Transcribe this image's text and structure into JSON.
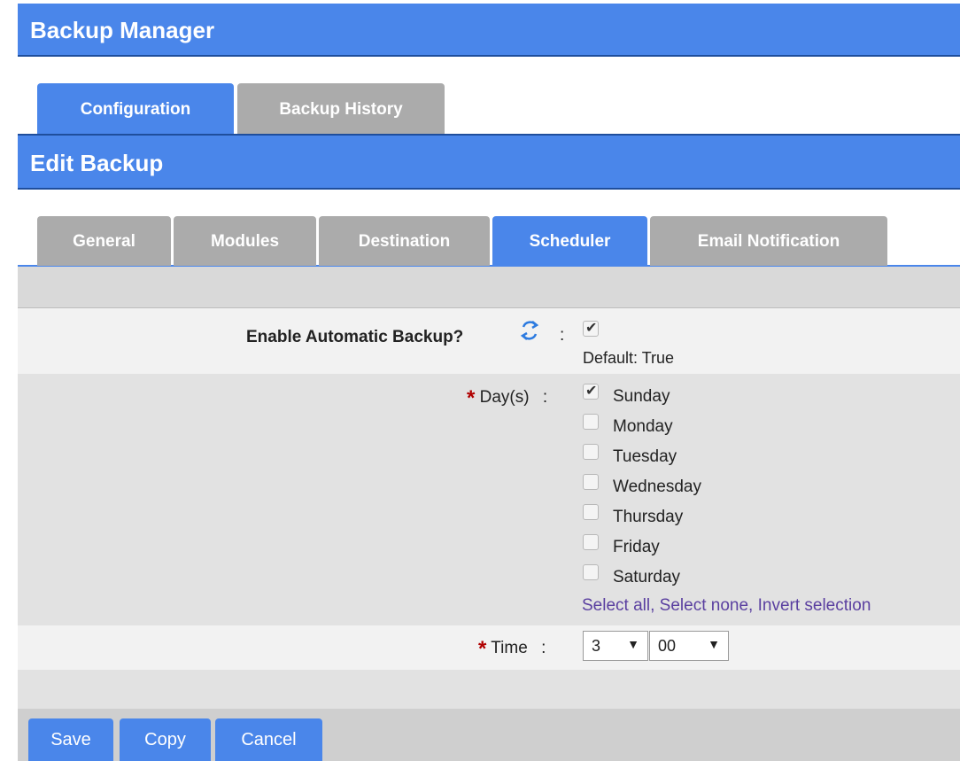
{
  "header": {
    "title": "Backup Manager"
  },
  "main_tabs": [
    {
      "label": "Configuration",
      "active": true
    },
    {
      "label": "Backup History",
      "active": false
    }
  ],
  "section": {
    "title": "Edit Backup"
  },
  "sub_tabs": [
    {
      "label": "General",
      "active": false
    },
    {
      "label": "Modules",
      "active": false
    },
    {
      "label": "Destination",
      "active": false
    },
    {
      "label": "Scheduler",
      "active": true
    },
    {
      "label": "Email Notification",
      "active": false
    }
  ],
  "form": {
    "enable": {
      "label": "Enable Automatic Backup?",
      "sep": ":",
      "checked": true,
      "default_text": "Default: True",
      "icon": "refresh-icon"
    },
    "days": {
      "required_mark": "*",
      "label": "Day(s)",
      "sep": ":",
      "options": [
        {
          "label": "Sunday",
          "checked": true
        },
        {
          "label": "Monday",
          "checked": false
        },
        {
          "label": "Tuesday",
          "checked": false
        },
        {
          "label": "Wednesday",
          "checked": false
        },
        {
          "label": "Thursday",
          "checked": false
        },
        {
          "label": "Friday",
          "checked": false
        },
        {
          "label": "Saturday",
          "checked": false
        }
      ],
      "links": {
        "select_all": "Select all",
        "select_none": "Select none",
        "invert": "Invert selection",
        "comma": ","
      }
    },
    "time": {
      "required_mark": "*",
      "label": "Time",
      "sep": ":",
      "hour": "3",
      "minute": "00",
      "arrow": "▼"
    }
  },
  "buttons": {
    "save": "Save",
    "copy": "Copy",
    "cancel": "Cancel"
  },
  "colors": {
    "accent": "#4a86ea",
    "required": "#b00000",
    "link": "#5a3fa0"
  }
}
